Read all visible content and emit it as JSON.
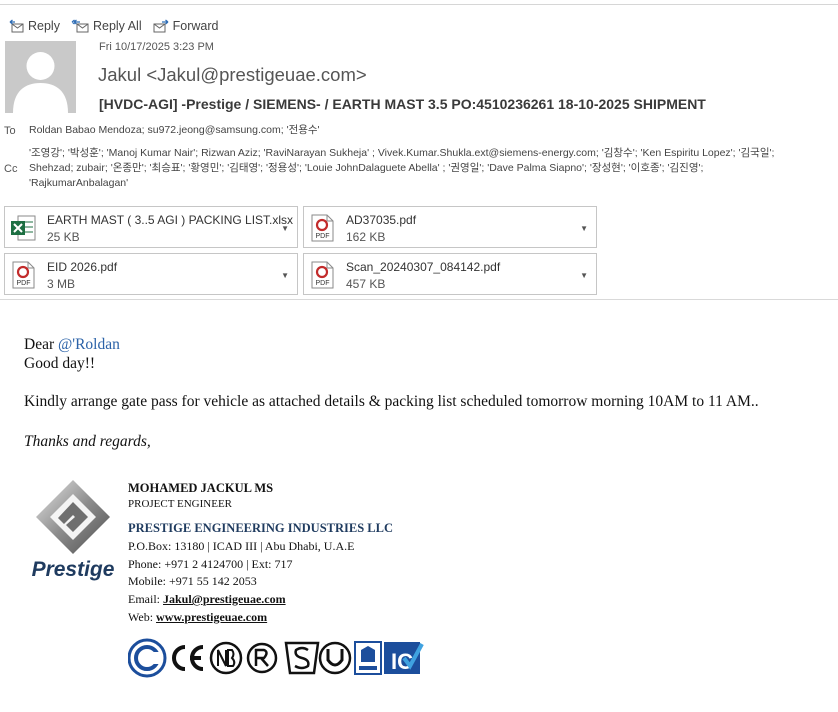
{
  "toolbar": {
    "reply": "Reply",
    "reply_all": "Reply All",
    "forward": "Forward"
  },
  "header": {
    "date": "Fri 10/17/2025 3:23 PM",
    "sender": "Jakul <Jakul@prestigeuae.com>",
    "subject": "[HVDC-AGI] -Prestige / SIEMENS-  / EARTH MAST 3.5 PO:4510236261 18-10-2025 SHIPMENT",
    "to_label": "To",
    "to": "Roldan Babao Mendoza; su972.jeong@samsung.com; '전용수'",
    "cc_label": "Cc",
    "cc_line1": "'조영강'; '박성훈'; 'Manoj Kumar Nair'; Rizwan Aziz; 'RaviNarayan Sukheja'    ; Vivek.Kumar.Shukla.ext@siemens-energy.com; '김창수'; 'Ken Espiritu Lopez'; '김국일';",
    "cc_line2": "Shehzad; zubair; '온종만'; '최승표'; '황영민'; '김태영'; '정용성'; 'Louie JohnDalaguete Abella'    ; '권영일'; 'Dave Palma Siapno'; '장성현'; '이호종'; '김진영';",
    "cc_line3": "'RajkumarAnbalagan'"
  },
  "attachments": [
    {
      "name": "EARTH MAST ( 3..5 AGI ) PACKING LIST.xlsx",
      "size": "25 KB",
      "type": "excel-icon"
    },
    {
      "name": "AD37035.pdf",
      "size": "162 KB",
      "type": "pdf-icon"
    },
    {
      "name": "EID 2026.pdf",
      "size": "3 MB",
      "type": "pdf-icon"
    },
    {
      "name": "Scan_20240307_084142.pdf",
      "size": "457 KB",
      "type": "pdf-icon"
    }
  ],
  "body": {
    "greeting": "Dear ",
    "mention": "@'Roldan",
    "good_day": "Good day!!",
    "request": "Kindly arrange gate pass for vehicle as attached details & packing list  scheduled tomorrow morning 10AM  to 11 AM..",
    "closing": "Thanks and regards,"
  },
  "signature": {
    "name": "MOHAMED JACKUL MS",
    "title": "PROJECT  ENGINEER",
    "company": "PRESTIGE ENGINEERING INDUSTRIES LLC",
    "address": "P.O.Box: 13180 | ICAD III | Abu Dhabi, U.A.E",
    "phone": "Phone: +971 2 4124700 | Ext: 717",
    "mobile": "Mobile: +971 55 142 2053",
    "email_label": "Email: ",
    "email": "Jakul@prestigeuae.com",
    "web_label": "Web:  ",
    "web": "www.prestigeuae.com",
    "logo_text": "Prestige"
  },
  "colors": {
    "pdf_red": "#c22b2b",
    "excel_green": "#1d6f42",
    "brand_navy": "#1f3b5f",
    "mention_blue": "#2b62a8"
  }
}
